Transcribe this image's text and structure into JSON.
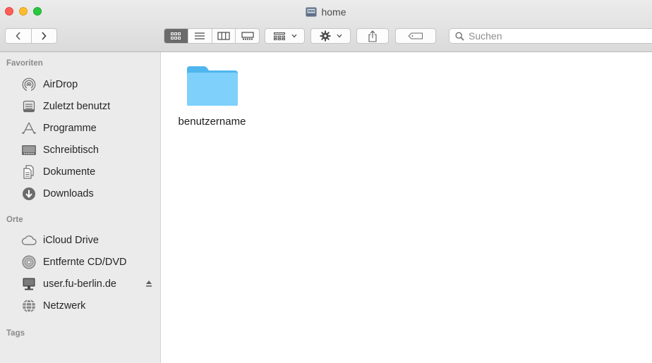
{
  "window": {
    "title": "home",
    "traffic_lights": {
      "close": "#ff5f57",
      "minimize": "#febc2e",
      "zoom": "#28c840"
    }
  },
  "toolbar": {
    "back_icon": "chevron-left-icon",
    "forward_icon": "chevron-right-icon",
    "view_modes": [
      "icon-view-icon",
      "list-view-icon",
      "column-view-icon",
      "gallery-view-icon"
    ],
    "active_view": "icon-view-icon",
    "group_icon": "group-by-icon",
    "action_icon": "gear-icon",
    "share_icon": "share-icon",
    "tag_icon": "tag-icon",
    "search": {
      "placeholder": "Suchen",
      "value": ""
    }
  },
  "sidebar": {
    "favorites_header": "Favoriten",
    "favorites": [
      {
        "label": "AirDrop",
        "icon": "airdrop-icon"
      },
      {
        "label": "Zuletzt benutzt",
        "icon": "recents-icon"
      },
      {
        "label": "Programme",
        "icon": "applications-icon"
      },
      {
        "label": "Schreibtisch",
        "icon": "desktop-icon"
      },
      {
        "label": "Dokumente",
        "icon": "documents-icon"
      },
      {
        "label": "Downloads",
        "icon": "downloads-icon"
      }
    ],
    "locations_header": "Orte",
    "locations": [
      {
        "label": "iCloud Drive",
        "icon": "cloud-icon"
      },
      {
        "label": "Entfernte CD/DVD",
        "icon": "disc-icon"
      },
      {
        "label": "user.fu-berlin.de",
        "icon": "server-icon"
      },
      {
        "label": "Netzwerk",
        "icon": "network-icon"
      }
    ],
    "tags_header": "Tags"
  },
  "content": {
    "items": [
      {
        "name": "benutzername",
        "kind": "folder",
        "color": "#5ac8fa"
      }
    ]
  }
}
